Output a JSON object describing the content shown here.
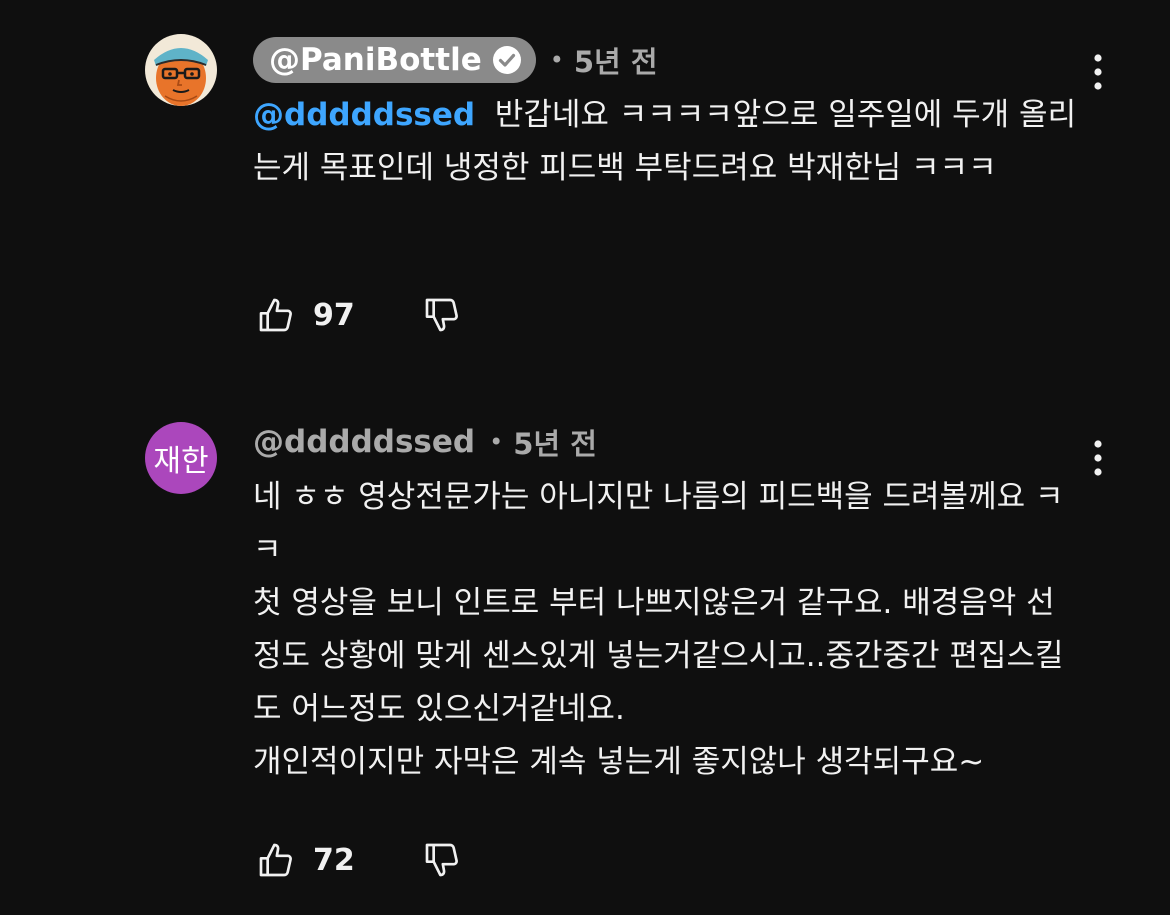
{
  "comments": [
    {
      "author": "@PaniBottle",
      "verified": true,
      "time": "5년 전",
      "mention": "@dddddssed",
      "text": "반갑네요 ㅋㅋㅋㅋ앞으로 일주일에 두개 올리는게 목표인데 냉정한 피드백 부탁드려요 박재한님 ㅋㅋㅋ",
      "likes": "97",
      "avatar_icon": "cartoon-face-avatar"
    },
    {
      "author": "@dddddssed",
      "verified": false,
      "time": "5년 전",
      "avatar_text": "재한",
      "text": "네 ㅎㅎ 영상전문가는 아니지만 나름의 피드백을 드려볼께요 ㅋㅋ\n첫 영상을 보니 인트로 부터 나쁘지않은거 같구요. 배경음악 선정도 상황에 맞게 센스있게 넣는거같으시고..중간중간 편집스킬도 어느정도 있으신거같네요.\n개인적이지만 자막은 계속 넣는게 좋지않나 생각되구요~",
      "likes": "72"
    }
  ],
  "colors": {
    "background": "#0f0f0f",
    "mention": "#3ea6ff",
    "author_chip": "#8a8a8a",
    "avatar_purple": "#ab47bc",
    "avatar_orange": "#e8742a"
  }
}
